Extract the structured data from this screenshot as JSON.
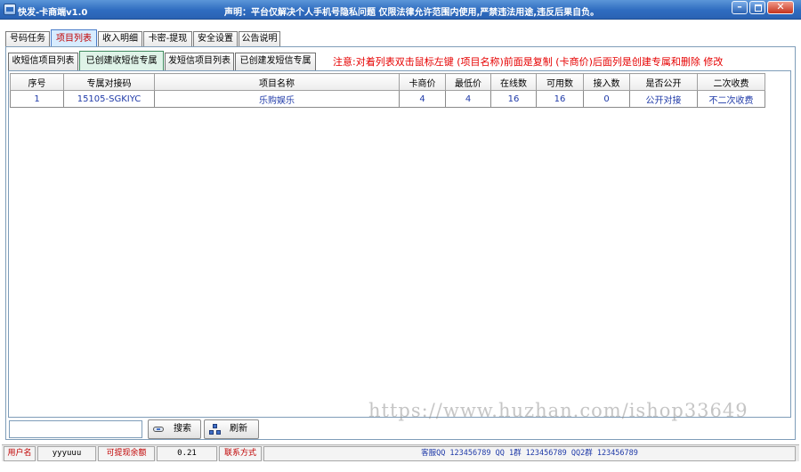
{
  "window": {
    "title": "快发-卡商端v1.0",
    "notice": "声明：平台仅解决个人手机号隐私问题 仅限法律允许范围内使用,严禁违法用途,违反后果自负。",
    "controls": {
      "minimize": "–",
      "close": "✕"
    }
  },
  "main_tabs": [
    "号码任务",
    "项目列表",
    "收入明细",
    "卡密-提现",
    "安全设置",
    "公告说明"
  ],
  "main_tab_active": "项目列表",
  "sub_tabs": [
    "收短信项目列表",
    "已创建收短信专属",
    "发短信项目列表",
    "已创建发短信专属"
  ],
  "sub_tab_active": "已创建收短信专属",
  "hint": "注意:对着列表双击鼠标左键 (项目名称)前面是复制 (卡商价)后面列是创建专属和删除 修改",
  "table": {
    "columns": [
      "序号",
      "专属对接码",
      "项目名称",
      "卡商价",
      "最低价",
      "在线数",
      "可用数",
      "接入数",
      "是否公开",
      "二次收费"
    ],
    "rows": [
      [
        "1",
        "15105-SGKIYC",
        "乐购娱乐",
        "4",
        "4",
        "16",
        "16",
        "0",
        "公开对接",
        "不二次收费"
      ]
    ]
  },
  "watermark": "https://www.huzhan.com/ishop33649",
  "toolbar": {
    "search_value": "",
    "search_button": "搜索",
    "refresh_button": "刷新"
  },
  "status": {
    "username_label": "用户名",
    "username": "yyyuuu",
    "balance_label": "可提现余额",
    "balance": "0.21",
    "contact_label": "联系方式",
    "contact": "客服QQ 123456789 QQ 1群 123456789 QQ2群 123456789"
  }
}
